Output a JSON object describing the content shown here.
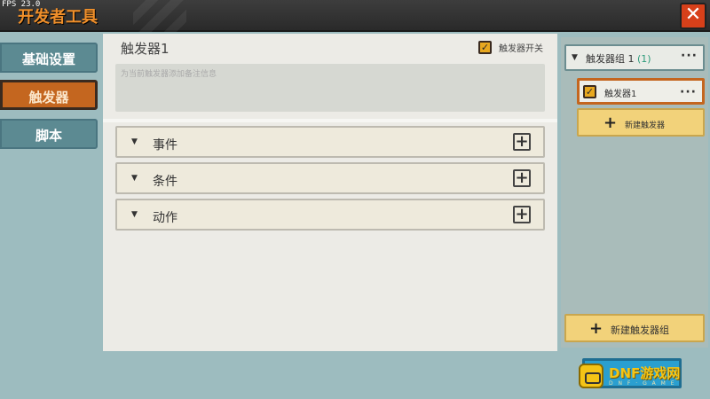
{
  "window": {
    "fps": "FPS 23.0",
    "title": "开发者工具"
  },
  "sidebar": {
    "items": [
      {
        "label": "基础设置",
        "active": false
      },
      {
        "label": "触发器",
        "active": true
      },
      {
        "label": "脚本",
        "active": false
      }
    ]
  },
  "main": {
    "trigger_name": "触发器1",
    "toggle_label": "触发器开关",
    "toggle_checked": true,
    "note_placeholder": "为当前触发器添加备注信息",
    "sections": [
      {
        "label": "事件"
      },
      {
        "label": "条件"
      },
      {
        "label": "动作"
      }
    ]
  },
  "right_panel": {
    "group_name": "触发器组 1",
    "group_count": "(1)",
    "trigger_item": "触发器1",
    "new_trigger_label": "新建触发器",
    "new_group_label": "新建触发器组"
  },
  "watermark": {
    "text": "DNF游戏网",
    "sub": "D N F · G A M E"
  },
  "colors": {
    "accent_orange": "#c4661f",
    "title_orange": "#f08f2a",
    "close_red": "#d7401a",
    "teal_bg": "#9dbcbf",
    "button_yellow": "#f2d27a"
  },
  "icons": {
    "close": "close-icon",
    "expand": "caret-down-icon",
    "add": "plus-icon",
    "more": "more-dots-icon",
    "check": "checkmark-icon"
  }
}
